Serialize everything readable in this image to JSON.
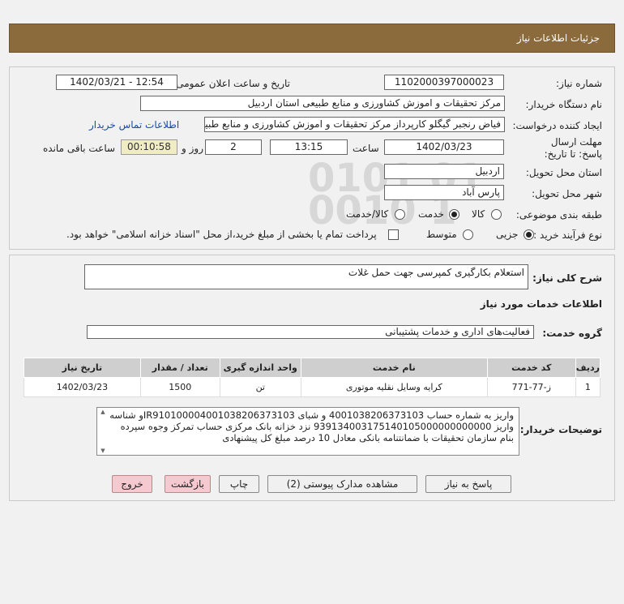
{
  "header": {
    "title": "جزئیات اطلاعات نیاز"
  },
  "form": {
    "need_number_label": "شماره نیاز:",
    "need_number": "1102000397000023",
    "announce_label": "تاریخ و ساعت اعلان عمومی:",
    "announce_value": "1402/03/21 - 12:54",
    "buyer_label": "نام دستگاه خریدار:",
    "buyer_value": "مرکز تحقیقات و اموزش کشاورزی و منابع طبیعی استان اردبیل",
    "creator_label": "ایجاد کننده درخواست:",
    "creator_value": "فیاض رنجبر گیگلو کارپرداز مرکز تحقیقات و اموزش کشاورزی و منابع طبیعی استان",
    "contact_link": "اطلاعات تماس خریدار",
    "deadline_label": "مهلت ارسال پاسخ: تا تاریخ:",
    "deadline_date": "1402/03/23",
    "time_label": "ساعت",
    "deadline_time": "13:15",
    "days_value": "2",
    "days_label": "روز و",
    "remaining_value": "00:10:58",
    "remaining_label": "ساعت باقی مانده",
    "province_label": "استان محل تحویل:",
    "province_value": "اردبیل",
    "city_label": "شهر محل تحویل:",
    "city_value": "پارس آباد",
    "category_label": "طبقه بندی موضوعی:",
    "category_options": [
      "کالا",
      "خدمت",
      "کالا/خدمت"
    ],
    "category_selected": "خدمت",
    "process_label": "نوع فرآیند خرید :",
    "process_options": [
      "جزیی",
      "متوسط"
    ],
    "process_selected": "جزیی",
    "treasury_note": "پرداخت تمام یا بخشی از مبلغ خرید،از محل \"اسناد خزانه اسلامی\" خواهد بود."
  },
  "details": {
    "summary_label": "شرح کلی نیاز:",
    "summary_value": "استعلام بکارگیری کمپرسی جهت حمل غلات",
    "services_heading": "اطلاعات خدمات مورد نیاز",
    "service_group_label": "گروه خدمت:",
    "service_group_value": "فعالیت‌های اداری و خدمات پشتیبانی",
    "table": {
      "headers": [
        "ردیف",
        "کد خدمت",
        "نام خدمت",
        "واحد اندازه گیری",
        "تعداد / مقدار",
        "تاریخ نیاز"
      ],
      "rows": [
        [
          "1",
          "ز-77-771",
          "کرایه وسایل نقلیه موتوری",
          "تن",
          "1500",
          "1402/03/23"
        ]
      ]
    },
    "buyer_notes_label": "توضیحات خریدار:",
    "buyer_notes": "واریز به شماره حساب 4001038206373103 و شبای IR910100004001038206373103و شناسه واریز 939134003175140105000000000000 نزد خزانه بانک مرکزی حساب تمرکز وجوه سپرده بنام سازمان تحقیقات با ضمانتنامه بانکی معادل 10 درصد مبلغ کل پیشنهادی"
  },
  "buttons": {
    "reply": "پاسخ به نیاز",
    "attachments": "مشاهده مدارک پیوستی (2)",
    "print": "چاپ",
    "back": "بازگشت",
    "exit": "خروج"
  }
}
